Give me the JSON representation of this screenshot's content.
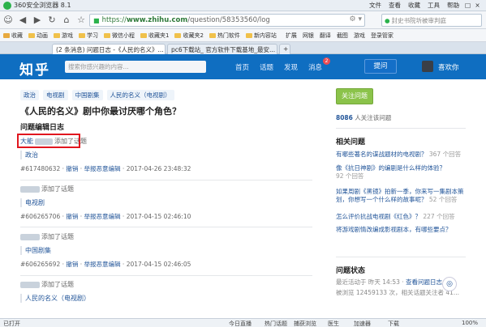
{
  "browser": {
    "title": "360安全浏览器 8.1",
    "window_menu": [
      "文件",
      "查看",
      "收藏",
      "工具",
      "帮助"
    ],
    "url_scheme": "https://",
    "url_host": "www.zhihu.com",
    "url_path": "/question/58353560/log",
    "search_placeholder": "封史书院圻被审判庭",
    "bookmarks": [
      "收藏",
      "动画",
      "游戏",
      "学习",
      "微信小程",
      "收藏夹1",
      "收藏夹2",
      "热门软件",
      "新内容站"
    ],
    "toolbar_right": [
      "扩展",
      "网银",
      "翻译",
      "截图",
      "游戏",
      "登录管家"
    ],
    "tabs": [
      {
        "label": "(2 条消息) 问题日志 -《人民的名义》...",
        "active": true
      },
      {
        "label": "pc6下载站_ 官方软件下载基地_最安...",
        "active": false
      }
    ]
  },
  "zhihu": {
    "logo": "知乎",
    "search_placeholder": "搜索你感兴趣的内容...",
    "nav": [
      "首页",
      "话题",
      "发现",
      "消息"
    ],
    "message_badge": "2",
    "ask_button": "提问",
    "username": "喜欢你"
  },
  "question": {
    "tags": [
      "政治",
      "电视剧",
      "中国剧集",
      "人民的名义（电视剧）"
    ],
    "title": "《人民的名义》剧中你最讨厌哪个角色？",
    "log_heading": "问题编辑日志",
    "entries": [
      {
        "user_prefix": "大能",
        "action": "添加了话题",
        "topic": "政治",
        "id": "#617480632",
        "revoke": "撤销",
        "report": "举报恶意编辑",
        "time": "2017-04-26 23:48:32"
      },
      {
        "user_prefix": "",
        "action": "添加了话题",
        "topic": "电视剧",
        "id": "#606265706",
        "revoke": "撤销",
        "report": "举报恶意编辑",
        "time": "2017-04-15 02:46:10"
      },
      {
        "user_prefix": "",
        "action": "添加了话题",
        "topic": "中国剧集",
        "id": "#606265692",
        "revoke": "撤销",
        "report": "举报恶意编辑",
        "time": "2017-04-15 02:46:05"
      },
      {
        "user_prefix": "",
        "action": "添加了话题",
        "topic": "人民的名义（电视剧）",
        "id": "",
        "revoke": "",
        "report": "",
        "time": ""
      }
    ]
  },
  "sidebar": {
    "follow_button": "关注问题",
    "follower_count": "8086",
    "follower_text": "人关注该问题",
    "related_heading": "相关问题",
    "related": [
      {
        "q": "有哪些著名的谍战题材的电视剧？",
        "count": "367 个回答"
      },
      {
        "q": "像《抗日神剧》的编剧是什么样的体验？",
        "count": "92 个回答"
      },
      {
        "q": "如果周剧《黑镜》拍新一季，你来写一集剧本策划，你想写一个什么样的故事呢？",
        "count": "52 个回答"
      },
      {
        "q": "怎么评价抗战电视剧《红色》？",
        "count": "227 个回答"
      },
      {
        "q": "将游戏剧情改编成影视剧本，有哪些要点？",
        "count": ""
      }
    ],
    "status_heading": "问题状态",
    "status_line1_prefix": "最近活动于 昨天 14:53 · ",
    "status_line1_link": "查看问题日志",
    "status_line2": "被浏览 12459133 次，相关话题关注者 41..."
  },
  "statusbar": {
    "left": "已打开",
    "items": [
      "今日直播",
      "热门话题",
      "捕获浏览",
      "医生",
      "加速器",
      "下载"
    ],
    "zoom": "100%"
  }
}
